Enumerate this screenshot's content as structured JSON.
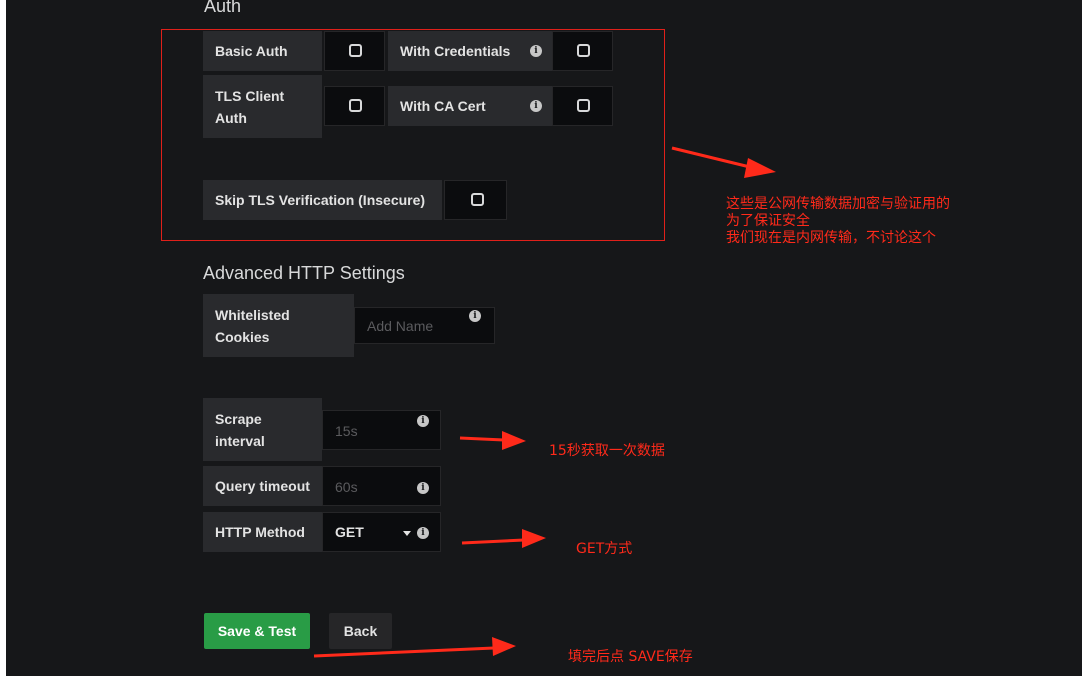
{
  "auth": {
    "title": "Auth",
    "basic_auth": "Basic Auth",
    "with_credentials": "With Credentials",
    "tls_client_auth_line1": "TLS Client",
    "tls_client_auth_line2": "Auth",
    "with_ca_cert": "With CA Cert",
    "skip_tls": "Skip TLS Verification (Insecure)"
  },
  "advanced": {
    "title": "Advanced HTTP Settings",
    "whitelisted_line1": "Whitelisted",
    "whitelisted_line2": "Cookies",
    "add_name_placeholder": "Add Name"
  },
  "settings": {
    "scrape_line1": "Scrape",
    "scrape_line2": "interval",
    "scrape_placeholder": "15s",
    "query_timeout": "Query timeout",
    "query_placeholder": "60s",
    "http_method": "HTTP Method",
    "http_method_value": "GET"
  },
  "buttons": {
    "save_test": "Save & Test",
    "back": "Back"
  },
  "annotations": {
    "auth_note_line1": "这些是公网传输数据加密与验证用的",
    "auth_note_line2": "为了保证安全",
    "auth_note_line3": "我们现在是内网传输，不讨论这个",
    "scrape_note": "15秒获取一次数据",
    "method_note": "GET方式",
    "save_note": "填完后点 SAVE保存"
  },
  "colors": {
    "background": "#161719",
    "label_bg": "#292a2d",
    "input_bg": "#0b0c0e",
    "save_green": "#299c46",
    "annotation_red": "#ff2a1a"
  },
  "icons": [
    "info-icon",
    "checkbox-icon",
    "caret-down-icon",
    "arrow-annotation"
  ]
}
